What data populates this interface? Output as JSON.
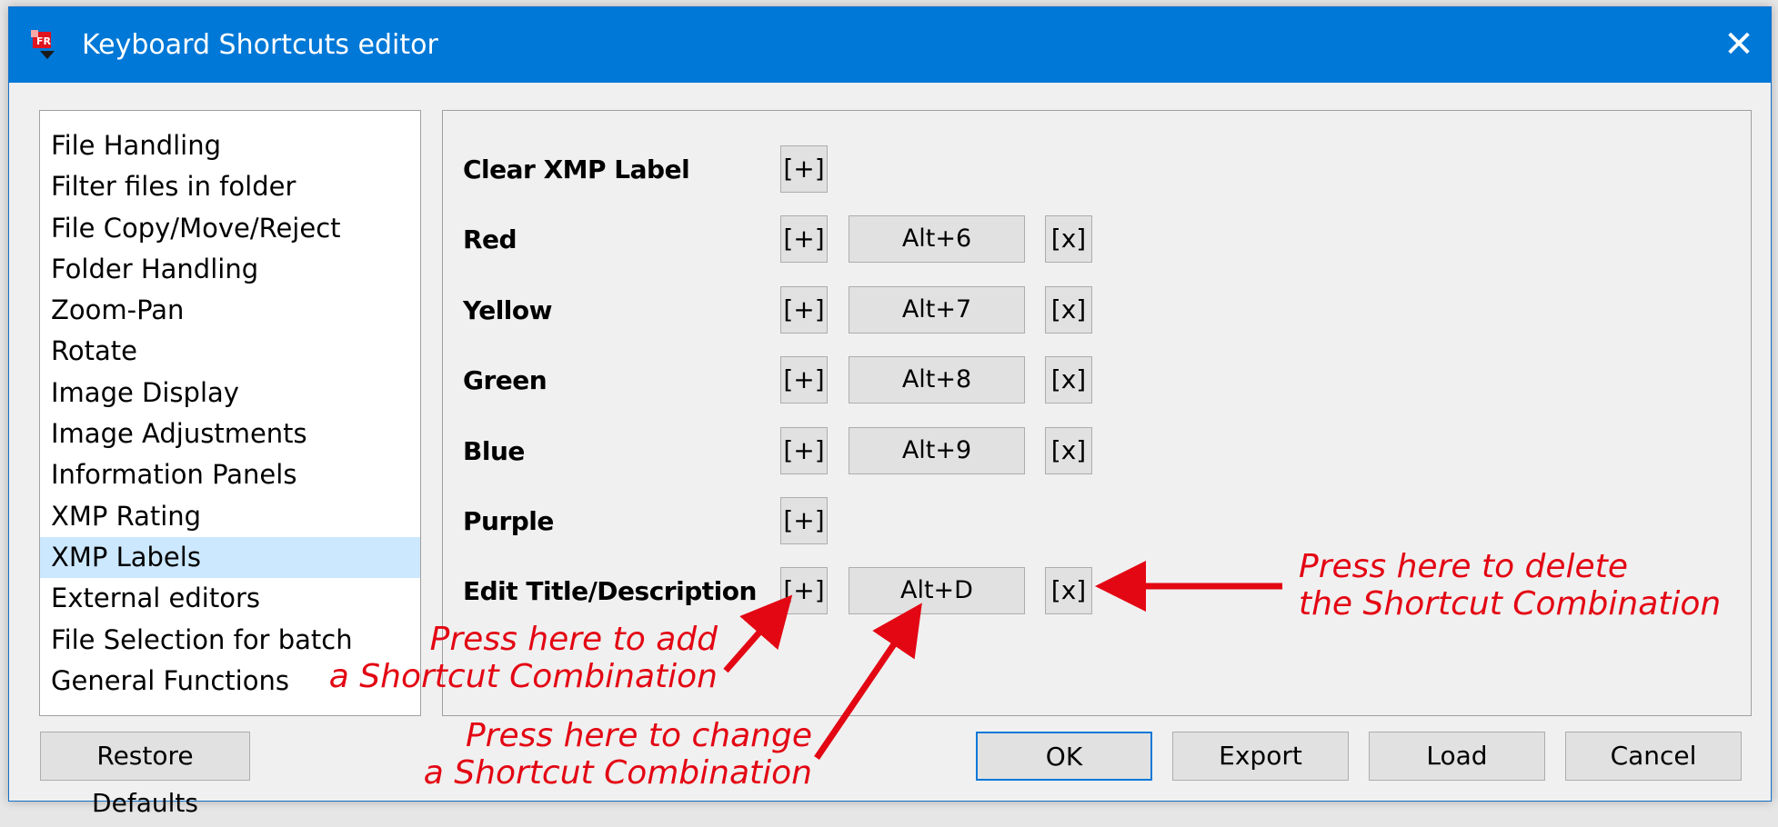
{
  "window": {
    "title": "Keyboard Shortcuts editor",
    "close_symbol": "✕",
    "accent_color": "#0078d7"
  },
  "categories": [
    {
      "label": "File Handling",
      "selected": false
    },
    {
      "label": "Filter files in folder",
      "selected": false
    },
    {
      "label": "File Copy/Move/Reject",
      "selected": false
    },
    {
      "label": "Folder Handling",
      "selected": false
    },
    {
      "label": "Zoom-Pan",
      "selected": false
    },
    {
      "label": "Rotate",
      "selected": false
    },
    {
      "label": "Image Display",
      "selected": false
    },
    {
      "label": "Image Adjustments",
      "selected": false
    },
    {
      "label": "Information Panels",
      "selected": false
    },
    {
      "label": "XMP Rating",
      "selected": false
    },
    {
      "label": "XMP Labels",
      "selected": true
    },
    {
      "label": "External editors",
      "selected": false
    },
    {
      "label": "File Selection for batch",
      "selected": false
    },
    {
      "label": "General Functions",
      "selected": false
    }
  ],
  "shortcuts": {
    "add_label": "[+]",
    "delete_label": "[x]",
    "rows": [
      {
        "label": "Clear XMP Label",
        "combo": null
      },
      {
        "label": "Red",
        "combo": "Alt+6"
      },
      {
        "label": "Yellow",
        "combo": "Alt+7"
      },
      {
        "label": "Green",
        "combo": "Alt+8"
      },
      {
        "label": "Blue",
        "combo": "Alt+9"
      },
      {
        "label": "Purple",
        "combo": null
      },
      {
        "label": "Edit Title/Description",
        "combo": "Alt+D"
      }
    ]
  },
  "footer": {
    "restore_label": "Restore Defaults",
    "ok_label": "OK",
    "export_label": "Export",
    "load_label": "Load",
    "cancel_label": "Cancel"
  },
  "annotations": {
    "color": "#e30613",
    "add": [
      "Press here to add",
      "a Shortcut Combination"
    ],
    "change": [
      "Press here to change",
      "a Shortcut Combination"
    ],
    "delete": [
      "Press here to delete",
      "the Shortcut Combination"
    ]
  }
}
